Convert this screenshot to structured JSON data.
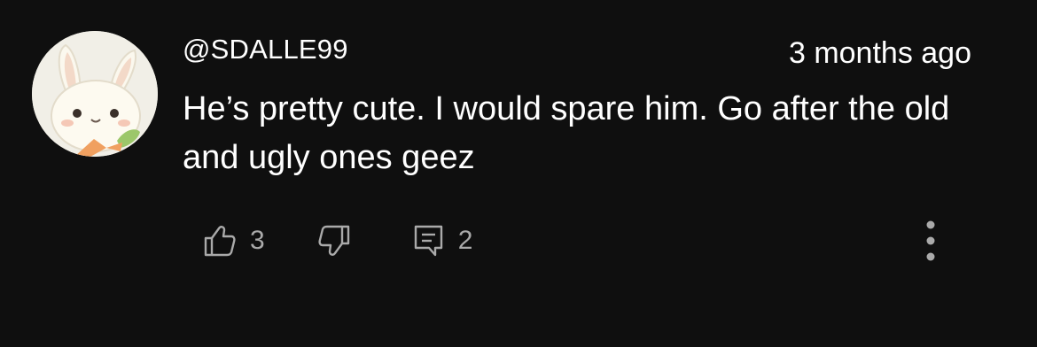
{
  "comment": {
    "username": "@SDALLE99",
    "timestamp": "3 months ago",
    "text": "He’s pretty cute. I would spare him. Go after the old and ugly ones geez"
  },
  "actions": {
    "like_count": "3",
    "reply_count": "2"
  },
  "icons": {
    "like": "thumbs-up-icon",
    "dislike": "thumbs-down-icon",
    "reply": "comment-icon",
    "more": "more-vertical-icon"
  },
  "colors": {
    "background": "#0f0f0f",
    "text_primary": "#ffffff",
    "text_secondary": "#aaaaaa"
  }
}
